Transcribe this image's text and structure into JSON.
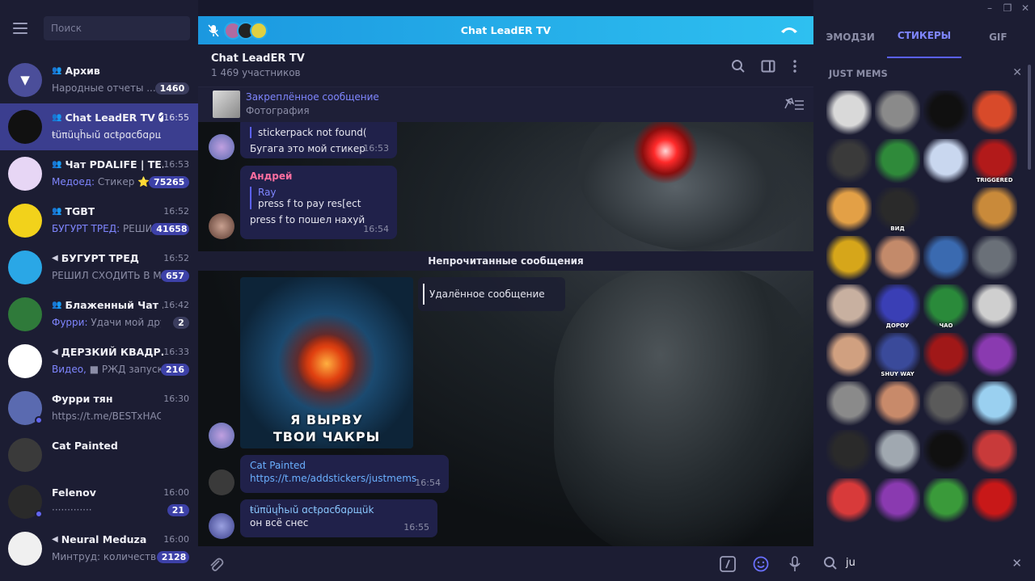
{
  "sidebar": {
    "search_placeholder": "Поиск",
    "chats": [
      {
        "name": "Архив",
        "preview": "Народные отчеты ...",
        "preview_hl": "",
        "time": "",
        "badge": "1460",
        "icon": "archive-icon",
        "avatar_color": "#4b4e9a"
      },
      {
        "name": "Chat LeadER TV",
        "preview": "ŧüπüųĥьıŭ ɑϲŧρɑϲбɑρщük: о...",
        "preview_hl": "",
        "time": "16:55",
        "badge": "",
        "icon": "group-icon",
        "avatar_color": "#111111",
        "verified": true
      },
      {
        "name": "Чат PDALIFE | TE...",
        "preview": "Стикер ⭐",
        "preview_hl": "Медоед: ",
        "time": "16:53",
        "badge": "75265",
        "icon": "group-icon",
        "avatar_color": "#e7d6f5"
      },
      {
        "name": "TGBT",
        "preview": "РЕШИ...",
        "preview_hl": "БУГУРТ ТРЕД: ",
        "time": "16:52",
        "badge": "41658",
        "icon": "group-icon",
        "avatar_color": "#f2d21b"
      },
      {
        "name": "БУГУРТ ТРЕД",
        "preview": "РЕШИЛ СХОДИТЬ В М...",
        "preview_hl": "",
        "time": "16:52",
        "badge": "657",
        "icon": "channel-icon",
        "avatar_color": "#2aa7e6"
      },
      {
        "name": "Блаженный Чат ...",
        "preview": "Удачи мой друг",
        "preview_hl": "Фурри: ",
        "time": "16:42",
        "badge": "2",
        "icon": "group-icon",
        "avatar_color": "#2f7a3a"
      },
      {
        "name": "ДЕРЗКИЙ КВАДР...",
        "preview": "■ РЖД запуск...",
        "preview_hl": "Видео, ",
        "time": "16:33",
        "badge": "216",
        "icon": "channel-icon",
        "avatar_color": "#ffffff"
      },
      {
        "name": "Фурри тян",
        "preview": "https://t.me/BESTxHACKERx",
        "preview_hl": "",
        "time": "16:30",
        "badge": "",
        "icon": "",
        "avatar_color": "#5a6ab0"
      },
      {
        "name": "Cat Painted",
        "preview": "",
        "preview_hl": "",
        "time": "",
        "badge": "",
        "icon": "",
        "avatar_color": "#3a3a3a"
      },
      {
        "name": "Felenov",
        "preview": "·············",
        "preview_hl": "",
        "time": "16:00",
        "badge": "21",
        "icon": "",
        "avatar_color": "#2a2a2a"
      },
      {
        "name": "Neural Meduza",
        "preview": "Минтруд: количеств...",
        "preview_hl": "",
        "time": "16:00",
        "badge": "2128",
        "icon": "channel-icon",
        "avatar_color": "#f0f0f0"
      }
    ]
  },
  "call": {
    "title": "Chat LeadER TV"
  },
  "chat": {
    "title": "Chat LeadER TV",
    "members": "1 469 участников",
    "pinned_title": "Закреплённое сообщение",
    "pinned_sub": "Фотография",
    "messages": {
      "m1_reply": "stickerpack not found(",
      "m1_text": "Бугага это мой стикер",
      "m1_time": "16:53",
      "m2_author": "Андрей",
      "m2_reply_author": "Ray",
      "m2_reply_text": "press f to pay res[ect",
      "m2_text": "press f to пошел нахуй",
      "m2_time": "16:54",
      "unread": "Непрочитанные сообщения",
      "sticker_caption_1": "Я ВЫРВУ",
      "sticker_caption_2": "ТВОИ ЧАКРЫ",
      "deleted": "Удалённое сообщение",
      "m3_author": "Cat Painted",
      "m3_link": "https://t.me/addstickers/justmems",
      "m3_time": "16:54",
      "m4_author": "ŧüπüųĥьıŭ ɑϲŧρɑϲбɑρщük",
      "m4_text": "он всё снес",
      "m4_time": "16:55"
    }
  },
  "panel": {
    "tabs": [
      "ЭМОДЗИ",
      "СТИКЕРЫ",
      "GIF"
    ],
    "active_tab": 1,
    "pack_title": "JUST MEMS",
    "search_value": "ju",
    "stickers": [
      {
        "color": "#d9d9d9",
        "label": ""
      },
      {
        "color": "#8a8a8a",
        "label": ""
      },
      {
        "color": "#101010",
        "label": ""
      },
      {
        "color": "#d84a2a",
        "label": ""
      },
      {
        "color": "#3a3a3a",
        "label": ""
      },
      {
        "color": "#2f8a3a",
        "label": ""
      },
      {
        "color": "#c9d7ef",
        "label": ""
      },
      {
        "color": "#b21a1a",
        "label": "TRIGGERED"
      },
      {
        "color": "#e3a046",
        "label": ""
      },
      {
        "color": "#2a2a2a",
        "label": "ВИД"
      },
      {
        "color": "#1c1d33",
        "label": ""
      },
      {
        "color": "#c98a3a",
        "label": ""
      },
      {
        "color": "#d6a61a",
        "label": ""
      },
      {
        "color": "#c38a6a",
        "label": ""
      },
      {
        "color": "#3a6ab0",
        "label": ""
      },
      {
        "color": "#6a7078",
        "label": ""
      },
      {
        "color": "#c8b0a0",
        "label": ""
      },
      {
        "color": "#3a3fb5",
        "label": "ДОРОУ"
      },
      {
        "color": "#2a8a3a",
        "label": "ЧАО"
      },
      {
        "color": "#cfcfcf",
        "label": ""
      },
      {
        "color": "#d0a080",
        "label": ""
      },
      {
        "color": "#3a4a9a",
        "label": "SHUY WAY"
      },
      {
        "color": "#a01818",
        "label": ""
      },
      {
        "color": "#8a3ab0",
        "label": ""
      },
      {
        "color": "#8a8a8a",
        "label": ""
      },
      {
        "color": "#c88a6a",
        "label": ""
      },
      {
        "color": "#5a5a5a",
        "label": ""
      },
      {
        "color": "#9ad0f0",
        "label": ""
      },
      {
        "color": "#2a2a2a",
        "label": ""
      },
      {
        "color": "#a0a8b0",
        "label": ""
      },
      {
        "color": "#101010",
        "label": ""
      },
      {
        "color": "#c83a3a",
        "label": ""
      },
      {
        "color": "#d83a3a",
        "label": ""
      },
      {
        "color": "#8a3ab0",
        "label": ""
      },
      {
        "color": "#3a9a3a",
        "label": ""
      },
      {
        "color": "#c81818",
        "label": ""
      }
    ]
  }
}
